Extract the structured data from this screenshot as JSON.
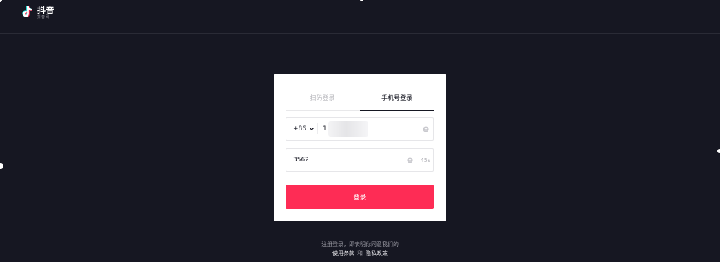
{
  "app": {
    "logo_name": "抖音",
    "logo_sub": "抖音网",
    "colors": {
      "background": "#161722",
      "card": "#ffffff",
      "primary_button": "#fe2c55",
      "active_text": "#161722",
      "inactive_text": "#b8b8bd"
    }
  },
  "login": {
    "tabs": [
      {
        "label": "扫码登录",
        "active": false
      },
      {
        "label": "手机号登录",
        "active": true
      }
    ],
    "phone": {
      "country_code": "+86",
      "value_prefix": "1"
    },
    "code": {
      "value": "3562",
      "countdown": "45s"
    },
    "submit_label": "登录"
  },
  "footer": {
    "agreement_text": "注册登录，即表明你同意我们的",
    "terms_link": "使用条款",
    "and_text": "和",
    "privacy_link": "隐私政策"
  }
}
